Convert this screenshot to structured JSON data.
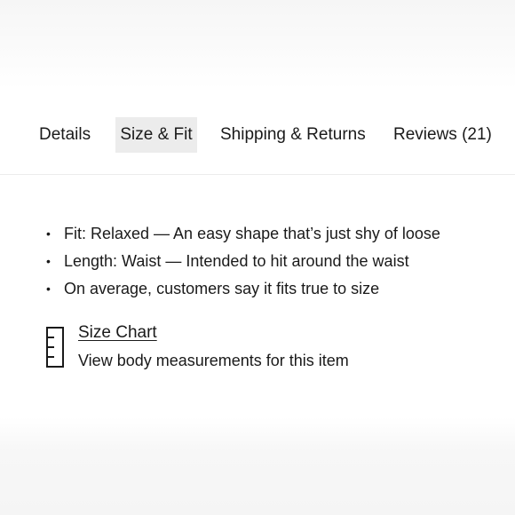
{
  "tabs": [
    {
      "label": "Details",
      "active": false
    },
    {
      "label": "Size & Fit",
      "active": true
    },
    {
      "label": "Shipping & Returns",
      "active": false
    },
    {
      "label": "Reviews (21)",
      "active": false
    }
  ],
  "fit": {
    "items": [
      "Fit: Relaxed — An easy shape that’s just shy of loose",
      "Length: Waist — Intended to hit around the waist",
      "On average, customers say it fits true to size"
    ]
  },
  "size_chart": {
    "icon": "ruler-icon",
    "link_label": "Size Chart",
    "description": "View body measurements for this item"
  },
  "colors": {
    "active_tab_bg": "#ececec",
    "text": "#1a1a1a"
  }
}
